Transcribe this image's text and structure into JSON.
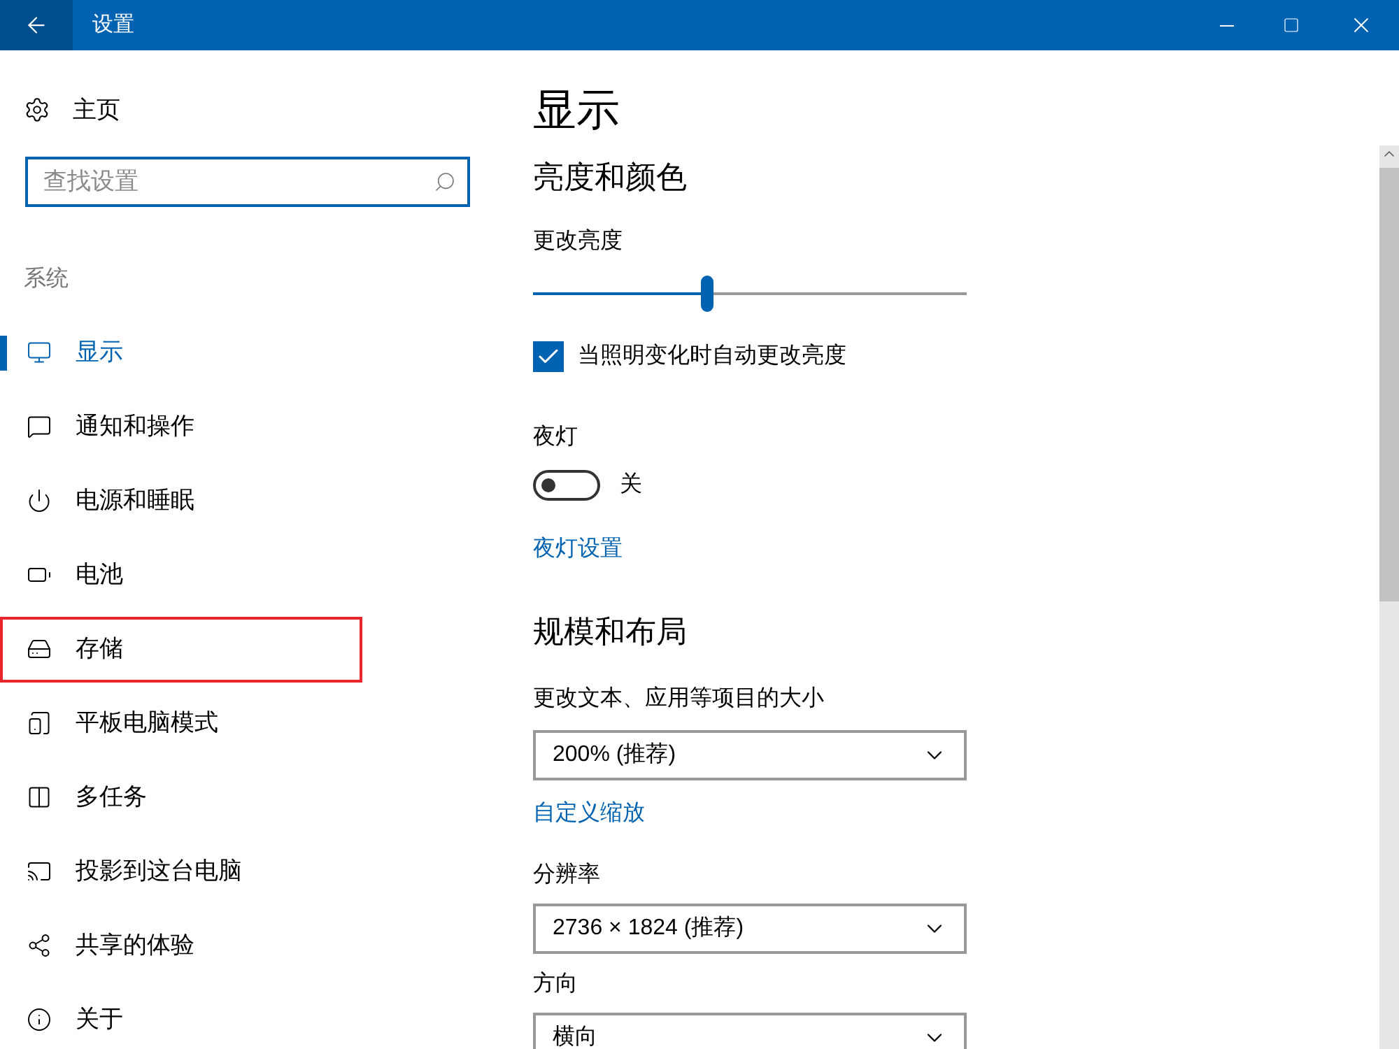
{
  "window": {
    "title": "设置"
  },
  "sidebar": {
    "home": "主页",
    "search": {
      "placeholder": "查找设置"
    },
    "section": "系统",
    "items": [
      {
        "label": "显示",
        "kind": "display",
        "selected": true,
        "annotated": false
      },
      {
        "label": "通知和操作",
        "kind": "notifications",
        "selected": false,
        "annotated": false
      },
      {
        "label": "电源和睡眠",
        "kind": "power",
        "selected": false,
        "annotated": false
      },
      {
        "label": "电池",
        "kind": "battery",
        "selected": false,
        "annotated": false
      },
      {
        "label": "存储",
        "kind": "storage",
        "selected": false,
        "annotated": true
      },
      {
        "label": "平板电脑模式",
        "kind": "tablet",
        "selected": false,
        "annotated": false
      },
      {
        "label": "多任务",
        "kind": "multitask",
        "selected": false,
        "annotated": false
      },
      {
        "label": "投影到这台电脑",
        "kind": "project",
        "selected": false,
        "annotated": false
      },
      {
        "label": "共享的体验",
        "kind": "share",
        "selected": false,
        "annotated": false
      },
      {
        "label": "关于",
        "kind": "about",
        "selected": false,
        "annotated": false
      }
    ]
  },
  "content": {
    "title": "显示",
    "brightness": {
      "heading": "亮度和颜色",
      "label": "更改亮度",
      "level": 0.4,
      "auto": {
        "label": "当照明变化时自动更改亮度",
        "checked": true
      }
    },
    "night_light": {
      "label": "夜灯",
      "on": false,
      "state": "关",
      "link": "夜灯设置"
    },
    "scale": {
      "heading": "规模和布局",
      "label": "更改文本、应用等项目的大小",
      "value": "200% (推荐)",
      "link": "自定义缩放"
    },
    "resolution": {
      "label": "分辨率",
      "value": "2736 × 1824 (推荐)"
    },
    "orientation": {
      "label": "方向",
      "value": "横向"
    }
  }
}
